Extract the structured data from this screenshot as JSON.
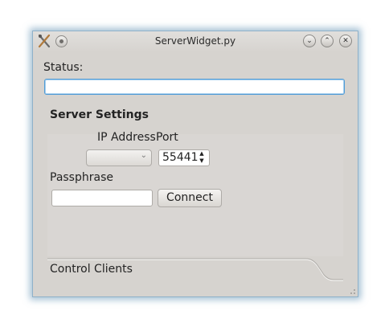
{
  "window": {
    "title": "ServerWidget.py",
    "accent_color": "#4f9bd6",
    "controls": {
      "minimize_glyph": "⌄",
      "maximize_glyph": "⌃",
      "close_glyph": "✕"
    }
  },
  "status": {
    "label": "Status:",
    "value": ""
  },
  "server_settings": {
    "title": "Server Settings",
    "ip_address_label": "IP Address",
    "port_label": "Port",
    "ip_address_value": "",
    "port_value": "55441",
    "passphrase_label": "Passphrase",
    "passphrase_value": "",
    "connect_label": "Connect"
  },
  "tabs": {
    "control_clients_label": "Control Clients"
  }
}
